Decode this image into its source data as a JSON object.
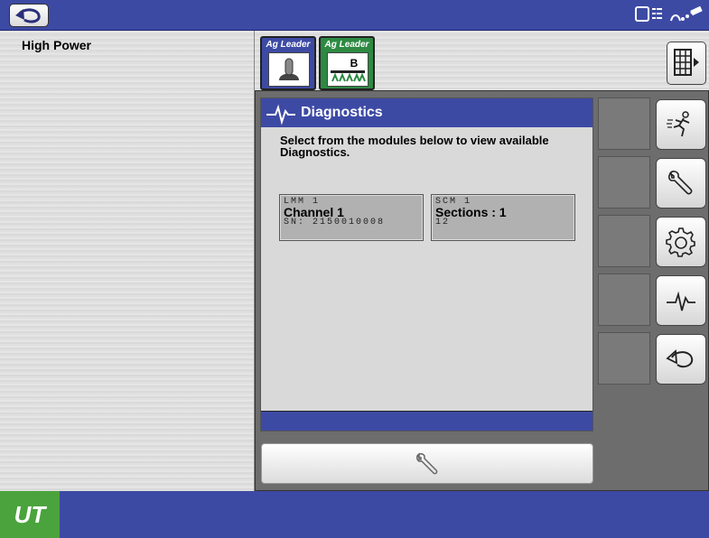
{
  "left_panel": {
    "title": "High Power"
  },
  "tabs": [
    {
      "brand": "Ag Leader"
    },
    {
      "brand": "Ag Leader",
      "badge": "B"
    }
  ],
  "dialog": {
    "title": "Diagnostics",
    "message": "Select from the modules below to view available Diagnostics.",
    "modules": [
      {
        "code": "LMM 1",
        "name": "Channel 1",
        "sub": "SN: 2150010008"
      },
      {
        "code": "SCM 1",
        "name": "Sections : 1",
        "sub": "12"
      }
    ]
  },
  "footer": {
    "logo_text": "UT"
  },
  "softkeys": [
    "runner-icon",
    "wrench-icon",
    "gear-icon",
    "pulse-icon",
    "undo-arrow-icon"
  ],
  "colors": {
    "bar_blue": "#3d4aa4",
    "logo_green": "#4aa33c",
    "tab_green": "#2d8a42"
  }
}
